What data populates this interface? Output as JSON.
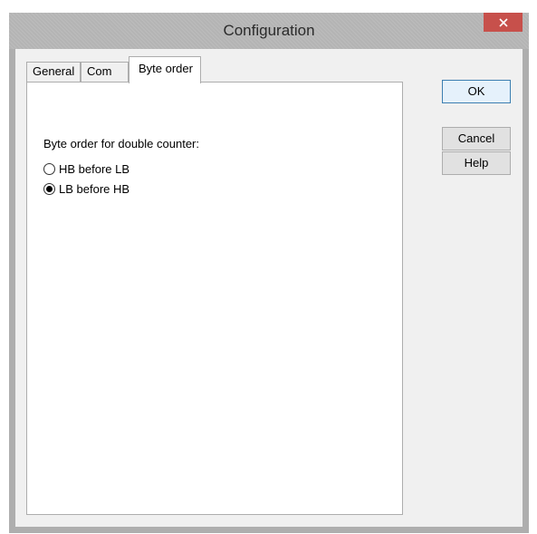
{
  "window": {
    "title": "Configuration",
    "close_symbol": "×"
  },
  "tabs": [
    {
      "label": "General",
      "selected": false
    },
    {
      "label": "Com",
      "selected": false
    },
    {
      "label": "Byte order",
      "selected": true
    }
  ],
  "byte_order": {
    "group_label": "Byte order for double counter:",
    "options": [
      {
        "label": "HB before LB",
        "selected": false
      },
      {
        "label": "LB before HB",
        "selected": true
      }
    ]
  },
  "buttons": {
    "ok": "OK",
    "cancel": "Cancel",
    "help": "Help"
  },
  "colors": {
    "close_button": "#c7504b",
    "dialog_face": "#f0f0f0",
    "default_button_border": "#3c7fb1"
  }
}
